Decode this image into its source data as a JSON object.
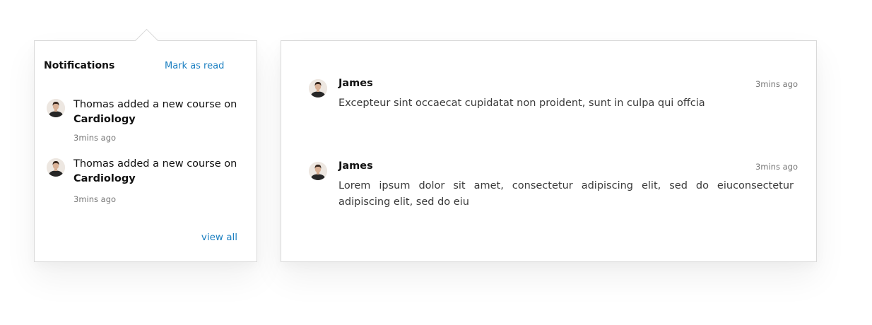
{
  "notifications": {
    "title": "Notifications",
    "mark_read_label": "Mark as read",
    "view_all_label": "view all",
    "items": [
      {
        "text": "Thomas added a new course on",
        "course": "Cardiology",
        "time": "3mins ago"
      },
      {
        "text": "Thomas added a new course on",
        "course": "Cardiology",
        "time": "3mins ago"
      }
    ]
  },
  "messages": {
    "items": [
      {
        "name": "James",
        "time": "3mins ago",
        "text": "Excepteur sint occaecat cupidatat non proident, sunt in culpa qui offcia"
      },
      {
        "name": "James",
        "time": "3mins ago",
        "text": "Lorem ipsum dolor sit amet, consectetur adipiscing elit, sed do eiuconsectetur adipiscing elit, sed do eiu"
      }
    ]
  },
  "colors": {
    "link": "#1b7fc1",
    "border": "#d9d9d9",
    "muted_text": "#777777"
  }
}
